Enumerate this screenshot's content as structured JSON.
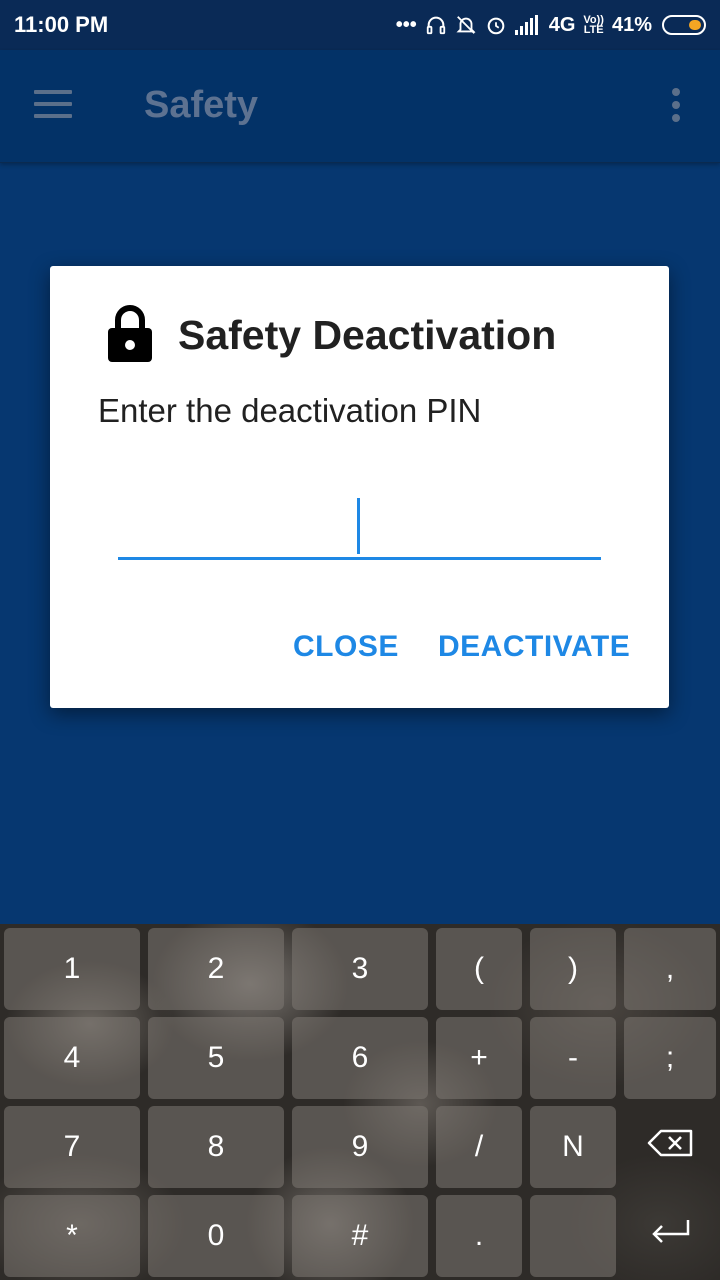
{
  "status_bar": {
    "time": "11:00 PM",
    "network": "4G",
    "volte": "Vo)) LTE",
    "battery": "41%"
  },
  "app_bar": {
    "title": "Safety",
    "menu_icon": "hamburger-menu-icon",
    "overflow_icon": "more-vert-icon"
  },
  "dialog": {
    "icon": "lock-icon",
    "title": "Safety Deactivation",
    "message": "Enter the deactivation PIN",
    "pin_value": "",
    "close_label": "CLOSE",
    "deactivate_label": "DEACTIVATE",
    "accent_color": "#1e88e5"
  },
  "keyboard": {
    "rows": [
      [
        "1",
        "2",
        "3",
        "(",
        ")",
        ","
      ],
      [
        "4",
        "5",
        "6",
        "+",
        "-",
        ";"
      ],
      [
        "7",
        "8",
        "9",
        "/",
        "N",
        "backspace-icon"
      ],
      [
        "*",
        "0",
        "#",
        ".",
        "",
        "enter-icon"
      ]
    ]
  },
  "colors": {
    "background": "#063770",
    "app_bar": "#033267",
    "status_bar": "#0a2a56"
  }
}
